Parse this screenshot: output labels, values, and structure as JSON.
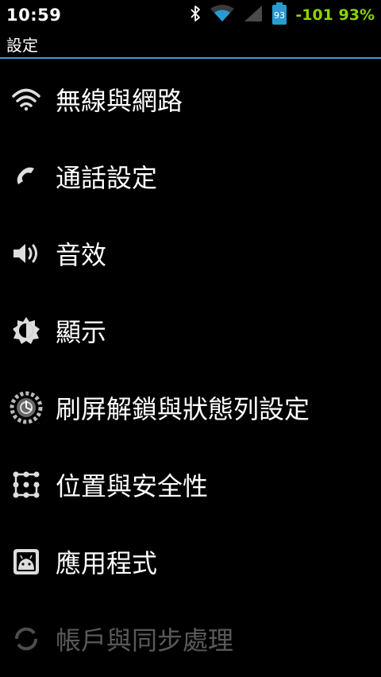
{
  "status": {
    "time": "10:59",
    "battery_level": "93",
    "signal_text": "-101 93%",
    "accent": "#3a9fd6",
    "signal_text_color": "#8ad300"
  },
  "titlebar": {
    "title": "設定"
  },
  "settings": {
    "items": [
      {
        "label": "無線與網路",
        "icon": "wifi-icon"
      },
      {
        "label": "通話設定",
        "icon": "phone-icon"
      },
      {
        "label": "音效",
        "icon": "speaker-icon"
      },
      {
        "label": "顯示",
        "icon": "brightness-icon"
      },
      {
        "label": "刷屏解鎖與狀態列設定",
        "icon": "lockscreen-gear-icon"
      },
      {
        "label": "位置與安全性",
        "icon": "location-security-grid-icon"
      },
      {
        "label": "應用程式",
        "icon": "android-app-icon"
      },
      {
        "label": "帳戶與同步處理",
        "icon": "sync-icon"
      }
    ]
  }
}
